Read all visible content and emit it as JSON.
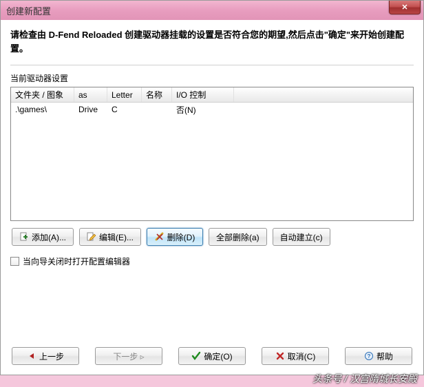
{
  "window": {
    "title": "创建新配置"
  },
  "instruction": "请检查由 D-Fend Reloaded 创建驱动器挂载的设置是否符合您的期望,然后点击\"确定\"来开始创建配置。",
  "section": {
    "label": "当前驱动器设置"
  },
  "table": {
    "headers": [
      "文件夹 / 图象",
      "as",
      "Letter",
      "名称",
      "I/O 控制"
    ],
    "rows": [
      {
        "folder": ".\\games\\",
        "as": "Drive",
        "letter": "C",
        "name": "",
        "io": "否(N)"
      }
    ]
  },
  "toolbar": {
    "add": "添加(A)...",
    "edit": "编辑(E)...",
    "delete": "删除(D)",
    "delete_all": "全部删除(a)",
    "auto_create": "自动建立(c)"
  },
  "checkbox": {
    "label": "当向导关闭时打开配置编辑器",
    "checked": false
  },
  "footer": {
    "prev": "上一步",
    "next": "下一步 ▹",
    "ok": "确定(O)",
    "cancel": "取消(C)",
    "help": "帮助"
  },
  "watermark": "头条号 / 汉宫隋城长安殿",
  "icons": {
    "add_color": "#2b7d2b",
    "edit_color": "#2b5fa0",
    "delete_color": "#b02f2f",
    "ok_color": "#1e8a1e",
    "cancel_color": "#c02828",
    "help_color": "#2d6fb7",
    "prev_color": "#b02020"
  }
}
